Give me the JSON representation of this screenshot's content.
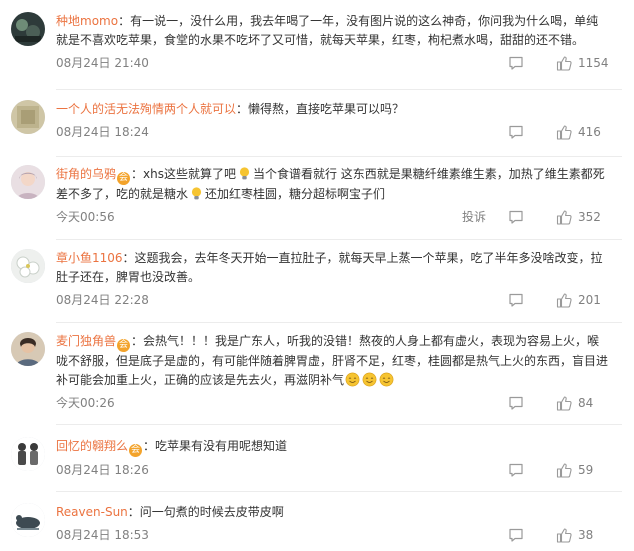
{
  "comments": [
    {
      "user": "种地momo",
      "text": "：有一说一，没什么用，我去年喝了一年，没有图片说的这么神奇，你问我为什么喝，单纯就是不喜欢吃苹果，食堂的水果不吃坏了又可惜，就每天苹果，红枣，枸杞煮水喝，甜甜的还不错。",
      "time": "08月24日 21:40",
      "likes": "1154",
      "avatar": "dark-avatar"
    },
    {
      "user": "一个人的活无法殉情两个人就可以",
      "text": "：懒得熬，直接吃苹果可以吗？",
      "time": "08月24日 18:24",
      "likes": "416",
      "avatar": "beige-avatar"
    },
    {
      "user": "街角的乌鸦",
      "badge": "会",
      "text_a": "：xhs这些就算了吧",
      "text_b": "当个食谱看就行 这东西就是果糖纤维素维生素，加热了维生素都死差不多了，吃的就是糖水",
      "text_c": "还加红枣桂圆，糖分超标啊宝子们",
      "emoji": "lightbulb-emoji",
      "time": "今天00:56",
      "report": "投诉",
      "likes": "352",
      "avatar": "girl-avatar"
    },
    {
      "user": "章小鱼1106",
      "text": "：这题我会，去年冬天开始一直拉肚子，就每天早上蒸一个苹果，吃了半年多没啥改变，拉肚子还在，脾胃也没改善。",
      "time": "08月24日 22:28",
      "likes": "201",
      "avatar": "flower-avatar"
    },
    {
      "user": "麦门独角兽",
      "badge": "会",
      "text": "：会热气！！！我是广东人，听我的没错！熬夜的人身上都有虚火，表现为容易上火，喉咙不舒服，但是底子是虚的，有可能伴随着脾胃虚，肝肾不足，红枣，桂圆都是热气上火的东西，盲目进补可能会加重上火，正确的应该是先去火，再滋阴补气",
      "emoji": "sweat-smile-emoji",
      "time": "今天00:26",
      "likes": "84",
      "avatar": "person-avatar"
    },
    {
      "user": "回忆的翱翔么",
      "badge": "会",
      "text": "：吃苹果有没有用呢想知道",
      "time": "08月24日 18:26",
      "likes": "59",
      "avatar": "couple-avatar"
    },
    {
      "user": "Reaven-Sun",
      "text": "：问一句煮的时候去皮带皮啊",
      "time": "08月24日 18:53",
      "likes": "38",
      "avatar": "animal-avatar"
    }
  ],
  "colors": {
    "username": "#eb7340",
    "text": "#333333",
    "meta": "#808080",
    "separator": "#ececec",
    "badge": "#f3a32b"
  },
  "icons": [
    "reply-icon",
    "like-icon",
    "lightbulb-emoji",
    "sweat-smile-emoji"
  ]
}
